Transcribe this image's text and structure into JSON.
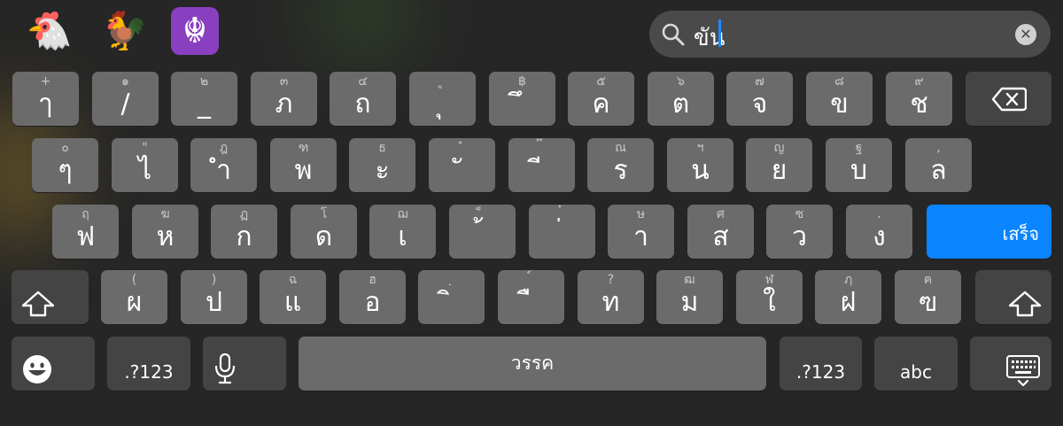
{
  "emoji_suggestions": [
    {
      "char": "🐔",
      "icon": "chicken-face-icon"
    },
    {
      "char": "🐓",
      "icon": "rooster-icon"
    },
    {
      "char": "☬",
      "icon": "khanda-icon"
    }
  ],
  "search": {
    "value": "ขัน",
    "icons": {
      "search": "magnifier-icon",
      "clear": "clear-icon"
    }
  },
  "row1": [
    {
      "hint": "+",
      "main": "ๅ"
    },
    {
      "hint": "๑",
      "main": "/"
    },
    {
      "hint": "๒",
      "main": "_"
    },
    {
      "hint": "๓",
      "main": "ภ"
    },
    {
      "hint": "๔",
      "main": "ถ"
    },
    {
      "hint": "ู",
      "main": "ุ"
    },
    {
      "hint": "฿",
      "main": "ึ"
    },
    {
      "hint": "๕",
      "main": "ค"
    },
    {
      "hint": "๖",
      "main": "ต"
    },
    {
      "hint": "๗",
      "main": "จ"
    },
    {
      "hint": "๘",
      "main": "ข"
    },
    {
      "hint": "๙",
      "main": "ช"
    }
  ],
  "row2": [
    {
      "hint": "๐",
      "main": "ๆ"
    },
    {
      "hint": "\"",
      "main": "ไ"
    },
    {
      "hint": "ฎ",
      "main": "ำ"
    },
    {
      "hint": "ฑ",
      "main": "พ"
    },
    {
      "hint": "ธ",
      "main": "ะ"
    },
    {
      "hint": "ํ",
      "main": "ั"
    },
    {
      "hint": "๊",
      "main": "ี"
    },
    {
      "hint": "ณ",
      "main": "ร"
    },
    {
      "hint": "ฯ",
      "main": "น"
    },
    {
      "hint": "ญ",
      "main": "ย"
    },
    {
      "hint": "ฐ",
      "main": "บ"
    },
    {
      "hint": ",",
      "main": "ล"
    }
  ],
  "row3": [
    {
      "hint": "ฤ",
      "main": "ฟ"
    },
    {
      "hint": "ฆ",
      "main": "ห"
    },
    {
      "hint": "ฏ",
      "main": "ก"
    },
    {
      "hint": "โ",
      "main": "ด"
    },
    {
      "hint": "ฌ",
      "main": "เ"
    },
    {
      "hint": "็",
      "main": "้"
    },
    {
      "hint": "๋",
      "main": "่"
    },
    {
      "hint": "ษ",
      "main": "า"
    },
    {
      "hint": "ศ",
      "main": "ส"
    },
    {
      "hint": "ซ",
      "main": "ว"
    },
    {
      "hint": ".",
      "main": "ง"
    }
  ],
  "row4": [
    {
      "hint": "(",
      "main": "ผ"
    },
    {
      "hint": ")",
      "main": "ป"
    },
    {
      "hint": "ฉ",
      "main": "แ"
    },
    {
      "hint": "ฮ",
      "main": "อ"
    },
    {
      "hint": "ฺ",
      "main": "ิ"
    },
    {
      "hint": "์",
      "main": "ื"
    },
    {
      "hint": "?",
      "main": "ท"
    },
    {
      "hint": "ฒ",
      "main": "ม"
    },
    {
      "hint": "ฬ",
      "main": "ใ"
    },
    {
      "hint": "ฦ",
      "main": "ฝ"
    },
    {
      "hint": "ฅ",
      "main": "ฃ"
    }
  ],
  "keys": {
    "done": "เสร็จ",
    "numbers_left": ".?123",
    "space": "วรรค",
    "numbers_right": ".?123",
    "abc": "abc"
  },
  "icons": {
    "delete": "backspace-icon",
    "shift": "shift-icon",
    "emoji": "emoji-face-icon",
    "mic": "microphone-icon",
    "hide_keyboard": "keyboard-dismiss-icon"
  },
  "colors": {
    "accent": "#0a84ff",
    "key": "#6b6b6b",
    "dark_key": "#444444",
    "background": "#262626"
  }
}
